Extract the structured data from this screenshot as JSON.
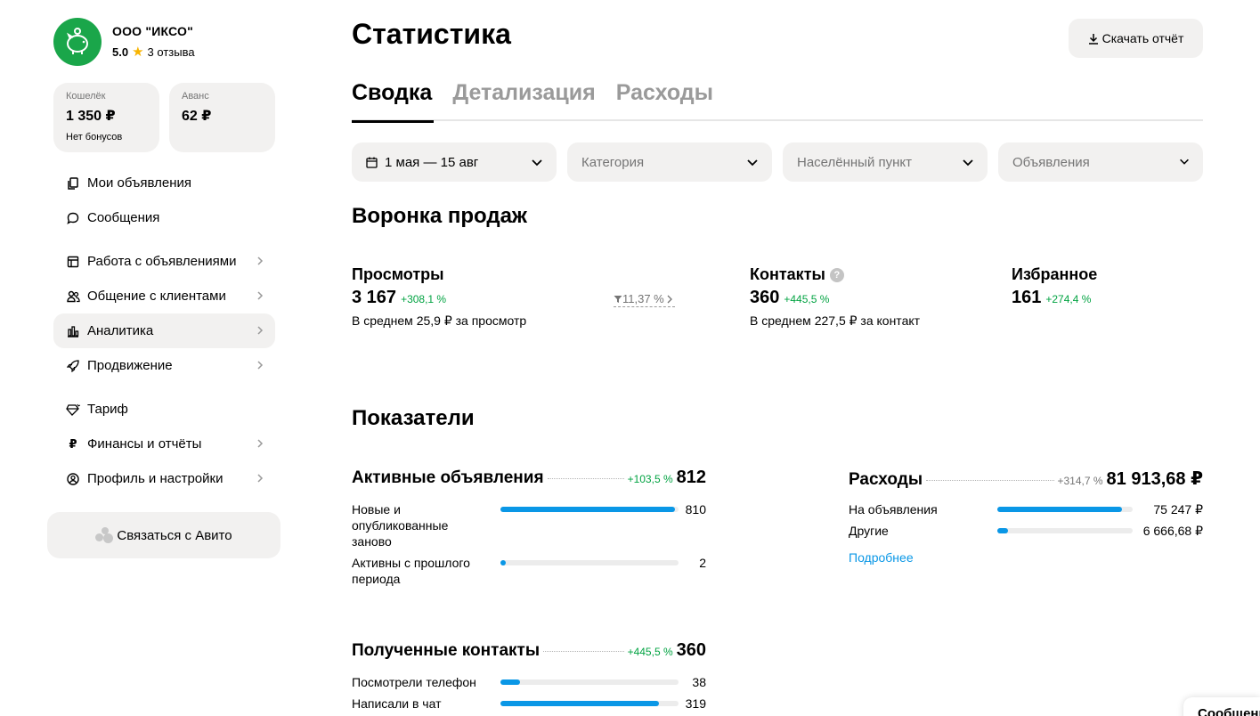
{
  "company": {
    "name": "ООО \"ИКСО\"",
    "score": "5.0",
    "reviews": "3 отзыва"
  },
  "wallets": [
    {
      "label": "Кошелёк",
      "value": "1 350 ₽",
      "sub": "Нет бонусов"
    },
    {
      "label": "Аванс",
      "value": "62 ₽",
      "sub": ""
    }
  ],
  "nav": {
    "items": [
      {
        "label": "Мои объявления",
        "icon": "copy-icon"
      },
      {
        "label": "Сообщения",
        "icon": "chat-bubble-icon"
      },
      {
        "label": "Работа с объявлениями",
        "icon": "ad-board-icon"
      },
      {
        "label": "Общение с клиентами",
        "icon": "people-icon"
      },
      {
        "label": "Аналитика",
        "icon": "bar-chart-icon"
      },
      {
        "label": "Продвижение",
        "icon": "rocket-icon"
      },
      {
        "label": "Тариф",
        "icon": "diamond-icon"
      },
      {
        "label": "Финансы и отчёты",
        "icon": "ruble-icon"
      },
      {
        "label": "Профиль и настройки",
        "icon": "user-circle-icon"
      }
    ],
    "contact_label": "Связаться с Авито"
  },
  "header": {
    "title": "Статистика",
    "download_label": "Скачать отчёт"
  },
  "tabs": [
    {
      "label": "Сводка"
    },
    {
      "label": "Детализация"
    },
    {
      "label": "Расходы"
    }
  ],
  "filters": {
    "date": "1 мая — 15 авг",
    "category": "Категория",
    "location": "Населённый пункт",
    "ads": "Объявления"
  },
  "funnel": {
    "title": "Воронка продаж",
    "views": {
      "label": "Просмотры",
      "value": "3 167",
      "change": "+308,1 %",
      "note": "В среднем 25,9 ₽ за просмотр"
    },
    "conversion": "11,37 %",
    "contacts": {
      "label": "Контакты",
      "value": "360",
      "change": "+445,5 %",
      "note": "В среднем 227,5 ₽ за контакт"
    },
    "favorites": {
      "label": "Избранное",
      "value": "161",
      "change": "+274,4 %"
    }
  },
  "metrics": {
    "title": "Показатели",
    "active_ads": {
      "title": "Активные объявления",
      "change": "+103,5 %",
      "total": "812",
      "rows": [
        {
          "label": "Новые и опубликованные заново",
          "value": "810",
          "fill": 0.98
        },
        {
          "label": "Активны с прошлого периода",
          "value": "2",
          "fill": 0.03
        }
      ]
    },
    "expenses": {
      "title": "Расходы",
      "change": "+314,7 %",
      "total": "81 913,68 ₽",
      "rows": [
        {
          "label": "На объявления",
          "value": "75 247 ₽",
          "fill": 0.92
        },
        {
          "label": "Другие",
          "value": "6 666,68 ₽",
          "fill": 0.08
        }
      ],
      "link": "Подробнее"
    },
    "contacts": {
      "title": "Полученные контакты",
      "change": "+445,5 %",
      "total": "360",
      "rows": [
        {
          "label": "Посмотрели телефон",
          "value": "38",
          "fill": 0.11
        },
        {
          "label": "Написали в чат",
          "value": "319",
          "fill": 0.89
        }
      ]
    }
  },
  "chat_widget": "Сообщения"
}
